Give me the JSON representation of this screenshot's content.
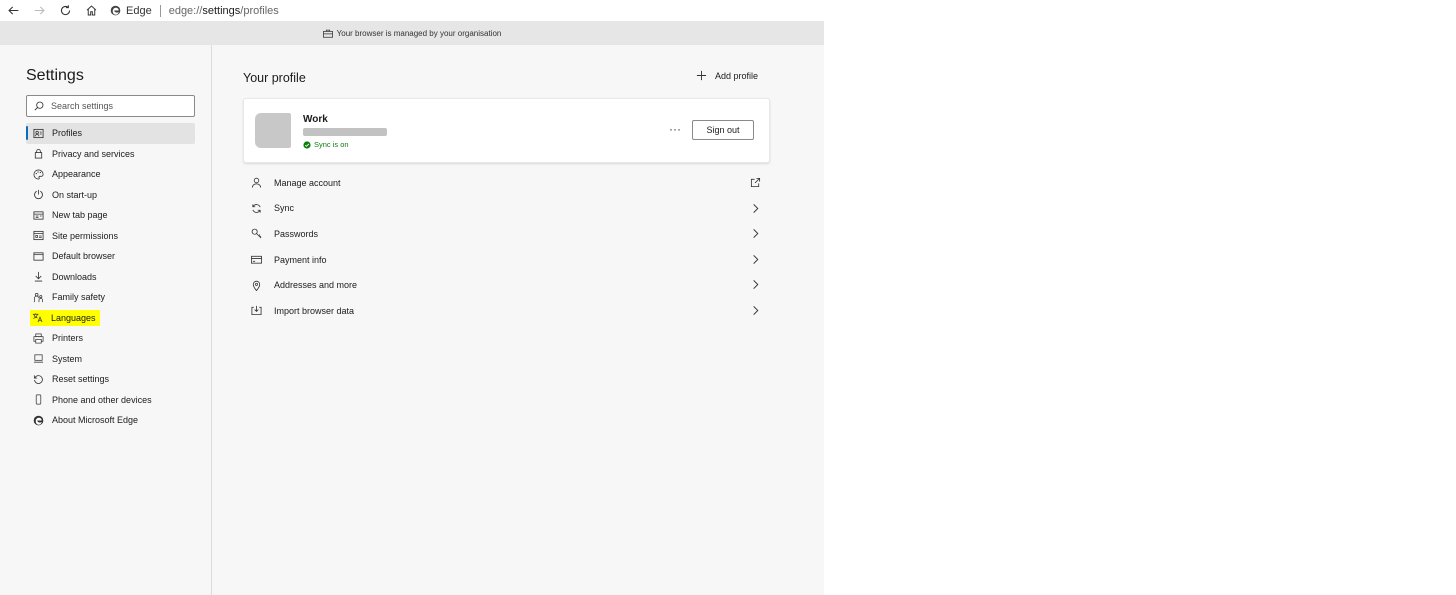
{
  "toolbar": {
    "site_name": "Edge",
    "url_prefix": "edge://",
    "url_main": "settings",
    "url_suffix": "/profiles"
  },
  "banner": {
    "text": "Your browser is managed by your organisation"
  },
  "sidebar": {
    "title": "Settings",
    "search_placeholder": "Search settings",
    "items": [
      {
        "label": "Profiles",
        "icon": "profile-icon",
        "active": true
      },
      {
        "label": "Privacy and services",
        "icon": "lock-icon"
      },
      {
        "label": "Appearance",
        "icon": "palette-icon"
      },
      {
        "label": "On start-up",
        "icon": "power-icon"
      },
      {
        "label": "New tab page",
        "icon": "new-tab-icon"
      },
      {
        "label": "Site permissions",
        "icon": "site-permissions-icon"
      },
      {
        "label": "Default browser",
        "icon": "browser-icon"
      },
      {
        "label": "Downloads",
        "icon": "download-icon"
      },
      {
        "label": "Family safety",
        "icon": "family-icon"
      },
      {
        "label": "Languages",
        "icon": "languages-icon",
        "highlighted": true
      },
      {
        "label": "Printers",
        "icon": "printer-icon"
      },
      {
        "label": "System",
        "icon": "system-icon"
      },
      {
        "label": "Reset settings",
        "icon": "reset-icon"
      },
      {
        "label": "Phone and other devices",
        "icon": "phone-icon"
      },
      {
        "label": "About Microsoft Edge",
        "icon": "edge-icon"
      }
    ]
  },
  "main": {
    "title": "Your profile",
    "add_profile_label": "Add profile",
    "profile": {
      "name": "Work",
      "sync_status": "Sync is on",
      "more_label": "···",
      "sign_out_label": "Sign out"
    },
    "rows": [
      {
        "label": "Manage account",
        "icon": "person-icon",
        "end": "external-link-icon"
      },
      {
        "label": "Sync",
        "icon": "sync-icon",
        "end": "chevron-right-icon"
      },
      {
        "label": "Passwords",
        "icon": "key-icon",
        "end": "chevron-right-icon"
      },
      {
        "label": "Payment info",
        "icon": "card-icon",
        "end": "chevron-right-icon"
      },
      {
        "label": "Addresses and more",
        "icon": "location-icon",
        "end": "chevron-right-icon"
      },
      {
        "label": "Import browser data",
        "icon": "import-icon",
        "end": "chevron-right-icon"
      }
    ]
  },
  "colors": {
    "accent": "#0f6cbd",
    "highlight": "#ffff00",
    "sync_green": "#107c10"
  }
}
